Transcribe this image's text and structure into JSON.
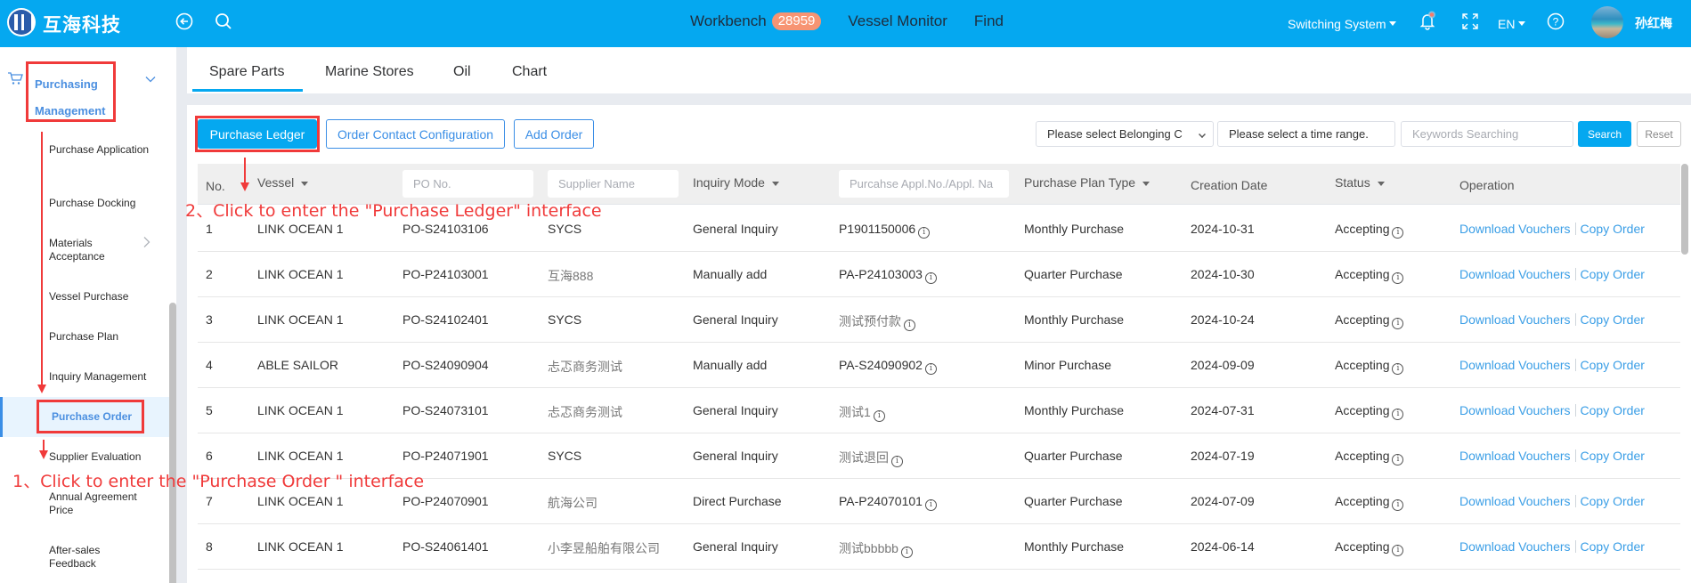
{
  "header": {
    "brand": "互海科技",
    "nav": [
      {
        "label": "Workbench",
        "badge": "28959"
      },
      {
        "label": "Vessel Monitor"
      },
      {
        "label": "Find"
      }
    ],
    "switch_system": "Switching System",
    "language": "EN",
    "user_name": "孙红梅",
    "badge_color": "#f79473",
    "brand_color": "#05a8f0"
  },
  "sidebar": {
    "parent": {
      "label_line1": "Purchasing",
      "label_line2": "Management",
      "icon": "cart-icon"
    },
    "items": [
      {
        "label": "Purchase Application"
      },
      {
        "label": "Purchase Docking"
      },
      {
        "label": "Materials Acceptance"
      },
      {
        "label": "Vessel Purchase"
      },
      {
        "label": "Purchase Plan"
      },
      {
        "label": "Inquiry Management"
      },
      {
        "label": "Purchase Order",
        "active": true
      },
      {
        "label": "Supplier Evaluation"
      },
      {
        "label": "Annual Agreement Price"
      },
      {
        "label": "After-sales Feedback"
      }
    ]
  },
  "tabs": [
    {
      "label": "Spare Parts",
      "active": true
    },
    {
      "label": "Marine Stores"
    },
    {
      "label": "Oil"
    },
    {
      "label": "Chart"
    }
  ],
  "toolbar": {
    "purchase_ledger": "Purchase Ledger",
    "order_contact_config": "Order Contact Configuration",
    "add_order": "Add Order",
    "belonging_select": "Please select Belonging C",
    "time_range_placeholder": "Please select a time range.",
    "keywords_placeholder": "Keywords Searching",
    "search": "Search",
    "reset": "Reset"
  },
  "table": {
    "headers": {
      "no": "No.",
      "vessel": "Vessel",
      "po_no_placeholder": "PO No.",
      "supplier_placeholder": "Supplier Name",
      "inquiry_mode": "Inquiry Mode",
      "appl_placeholder": "Purcahse Appl.No./Appl. Na",
      "plan_type": "Purchase Plan Type",
      "creation_date": "Creation Date",
      "status": "Status",
      "operation": "Operation"
    },
    "rows": [
      {
        "no": "1",
        "vessel": "LINK OCEAN 1",
        "po": "PO-S24103106",
        "supplier": "SYCS",
        "inquiry": "General Inquiry",
        "appl": "P1901150006",
        "plan": "Monthly Purchase",
        "date": "2024-10-31",
        "status": "Accepting",
        "op1": "Download Vouchers",
        "op2": "Copy Order"
      },
      {
        "no": "2",
        "vessel": "LINK OCEAN 1",
        "po": "PO-P24103001",
        "supplier": "互海888",
        "inquiry": "Manually add",
        "appl": "PA-P24103003",
        "plan": "Quarter Purchase",
        "date": "2024-10-30",
        "status": "Accepting",
        "op1": "Download Vouchers",
        "op2": "Copy Order"
      },
      {
        "no": "3",
        "vessel": "LINK OCEAN 1",
        "po": "PO-S24102401",
        "supplier": "SYCS",
        "inquiry": "General Inquiry",
        "appl": "测试预付款",
        "plan": "Monthly Purchase",
        "date": "2024-10-24",
        "status": "Accepting",
        "op1": "Download Vouchers",
        "op2": "Copy Order"
      },
      {
        "no": "4",
        "vessel": "ABLE SAILOR",
        "po": "PO-S24090904",
        "supplier": "忐忑商务测试",
        "inquiry": "Manually add",
        "appl": "PA-S24090902",
        "plan": "Minor Purchase",
        "date": "2024-09-09",
        "status": "Accepting",
        "op1": "Download Vouchers",
        "op2": "Copy Order"
      },
      {
        "no": "5",
        "vessel": "LINK OCEAN 1",
        "po": "PO-S24073101",
        "supplier": "忐忑商务测试",
        "inquiry": "General Inquiry",
        "appl": "测试1",
        "plan": "Monthly Purchase",
        "date": "2024-07-31",
        "status": "Accepting",
        "op1": "Download Vouchers",
        "op2": "Copy Order"
      },
      {
        "no": "6",
        "vessel": "LINK OCEAN 1",
        "po": "PO-P24071901",
        "supplier": "SYCS",
        "inquiry": "General Inquiry",
        "appl": "测试退回",
        "plan": "Quarter Purchase",
        "date": "2024-07-19",
        "status": "Accepting",
        "op1": "Download Vouchers",
        "op2": "Copy Order"
      },
      {
        "no": "7",
        "vessel": "LINK OCEAN 1",
        "po": "PO-P24070901",
        "supplier": "航海公司",
        "inquiry": "Direct Purchase",
        "appl": "PA-P24070101",
        "plan": "Quarter Purchase",
        "date": "2024-07-09",
        "status": "Accepting",
        "op1": "Download Vouchers",
        "op2": "Copy Order"
      },
      {
        "no": "8",
        "vessel": "LINK OCEAN 1",
        "po": "PO-S24061401",
        "supplier": "小李昱船舶有限公司",
        "inquiry": "General Inquiry",
        "appl": "测试bbbbb",
        "plan": "Monthly Purchase",
        "date": "2024-06-14",
        "status": "Accepting",
        "op1": "Download Vouchers",
        "op2": "Copy Order"
      }
    ]
  },
  "annotations": {
    "step1": "1、Click to enter the \"Purchase Order \" interface",
    "step2": "2、Click to enter the \"Purchase Ledger\" interface",
    "color": "#f03a3a"
  }
}
